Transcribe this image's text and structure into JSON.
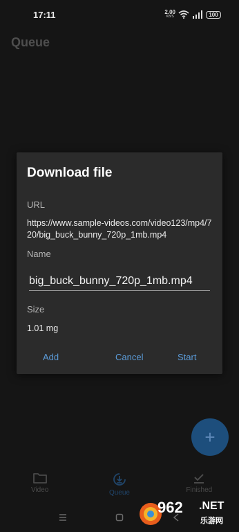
{
  "status": {
    "time": "17:11",
    "speed_value": "2.00",
    "speed_unit": "KB/S",
    "battery": "100"
  },
  "app": {
    "title": "Queue"
  },
  "dialog": {
    "title": "Download file",
    "url_label": "URL",
    "url_value": "https://www.sample-videos.com/video123/mp4/720/big_buck_bunny_720p_1mb.mp4",
    "name_label": "Name",
    "name_value": "big_buck_bunny_720p_1mb.mp4",
    "size_label": "Size",
    "size_value": "1.01 mg",
    "add_label": "Add",
    "cancel_label": "Cancel",
    "start_label": "Start"
  },
  "fab": {
    "icon": "plus-icon"
  },
  "bottom_nav": {
    "items": [
      {
        "label": "Video",
        "icon": "folder-icon",
        "active": false
      },
      {
        "label": "Queue",
        "icon": "download-circle-icon",
        "active": true
      },
      {
        "label": "Finished",
        "icon": "checkmark-icon",
        "active": false
      }
    ]
  },
  "watermark": {
    "number": "962",
    "net": ".NET",
    "cn": "乐游网"
  },
  "colors": {
    "accent": "#5b9bd8",
    "fab": "#1d4e7c",
    "dialog_bg": "#2b2b2b",
    "page_bg": "#151515"
  }
}
